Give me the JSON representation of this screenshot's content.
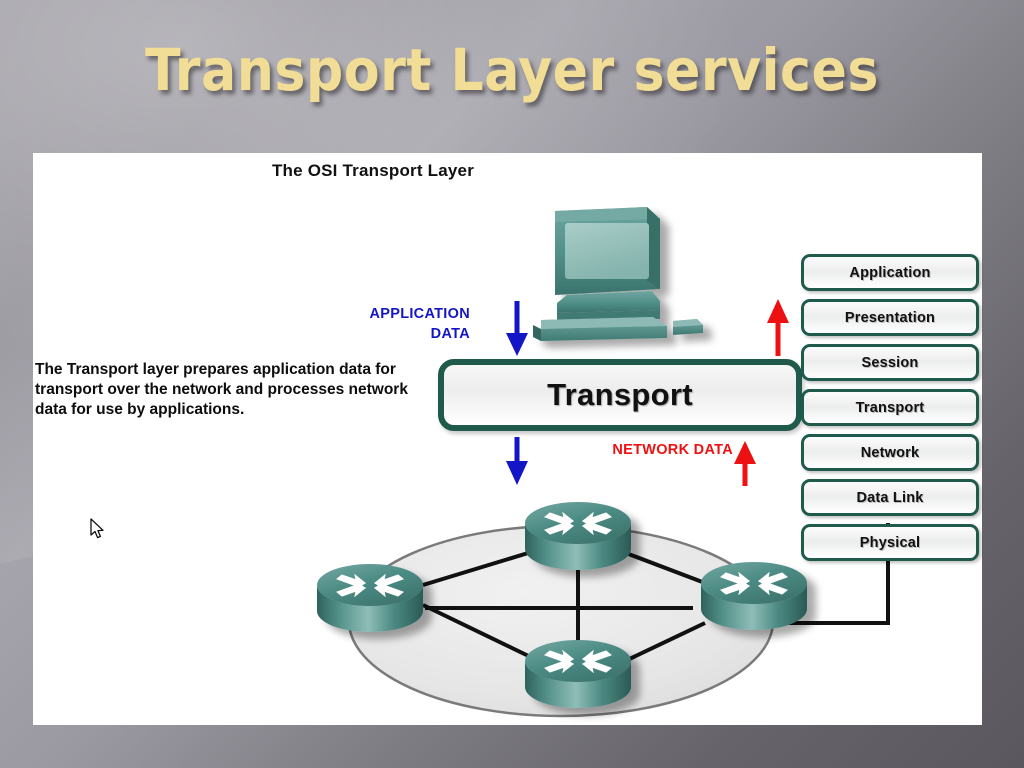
{
  "slide": {
    "title": "Transport Layer services",
    "title_color": "#f2dd96",
    "background_colors": [
      "#a5a3ab",
      "#7e7c83",
      "#5a585e"
    ]
  },
  "figure": {
    "title": "The OSI Transport Layer",
    "description": "The Transport layer prepares application data for transport over the network and processes network data for use by applications.",
    "center_box_label": "Transport",
    "center_box_border_color": "#1f5a4b",
    "labels": {
      "application_data_line1": "APPLICATION",
      "application_data_line2": "DATA",
      "application_data_color": "#1515c8",
      "network_data": "NETWORK DATA",
      "network_data_color": "#ee1111"
    },
    "icons": {
      "computer": "desktop-computer-icon",
      "router": "router-icon",
      "cloud": "network-cloud-ellipse",
      "down_arrow": "arrow-down-icon",
      "up_arrow": "arrow-up-icon",
      "pointer": "mouse-cursor-icon"
    },
    "icon_colors": {
      "device_teal": "#4f8f88",
      "device_teal_dark": "#35665f",
      "device_teal_light": "#8fb9b4",
      "cloud_fill": "#e8e8e8",
      "cloud_stroke": "#7a7a7a"
    },
    "router_count": 4
  },
  "osi_stack": {
    "layers": [
      {
        "label": "Application"
      },
      {
        "label": "Presentation"
      },
      {
        "label": "Session"
      },
      {
        "label": "Transport"
      },
      {
        "label": "Network"
      },
      {
        "label": "Data Link"
      },
      {
        "label": "Physical"
      }
    ],
    "border_color": "#1f5a4b"
  }
}
